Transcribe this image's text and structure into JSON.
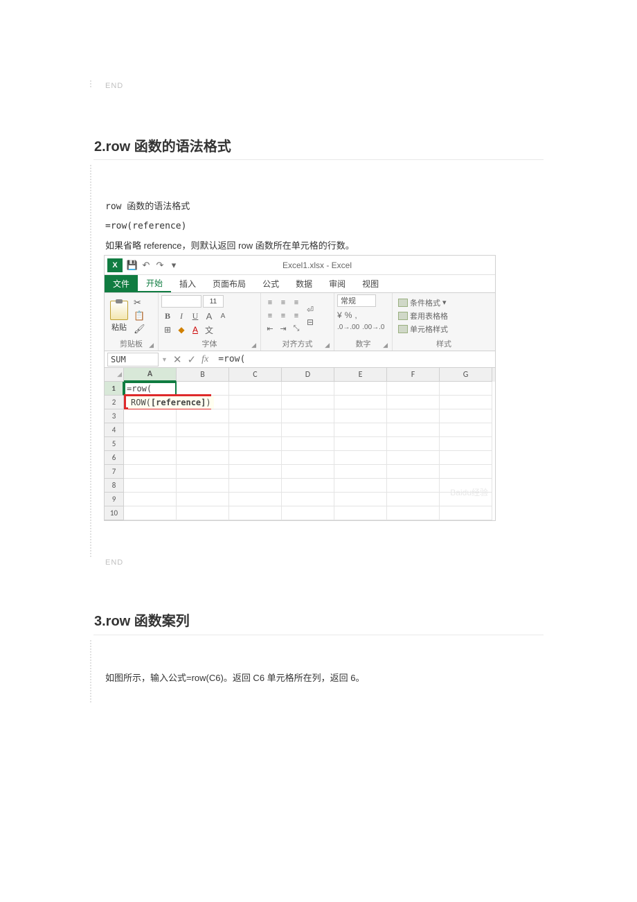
{
  "endLabel": "END",
  "section2": {
    "heading": "2.row 函数的语法格式",
    "line1": "row 函数的语法格式",
    "line2": "=row(reference)",
    "line3": "如果省略 reference，则默认返回 row 函数所在单元格的行数。"
  },
  "section3": {
    "heading": "3.row 函数案列",
    "line1": "如图所示，输入公式=row(C6)。返回 C6 单元格所在列，返回 6。"
  },
  "excel": {
    "title": "Excel1.xlsx - Excel",
    "qat": {
      "save": "💾",
      "undo": "↶",
      "redo": "↷"
    },
    "tabs": {
      "file": "文件",
      "home": "开始",
      "insert": "插入",
      "layout": "页面布局",
      "formulas": "公式",
      "data": "数据",
      "review": "审阅",
      "view": "视图"
    },
    "ribbon": {
      "clipboard": {
        "paste": "粘贴",
        "label": "剪贴板",
        "cut": "✂",
        "copy": "📋",
        "brush": "🖌"
      },
      "font": {
        "label": "字体",
        "size": "11",
        "b": "B",
        "i": "I",
        "u": "U",
        "grow": "A",
        "shrink": "A"
      },
      "alignment": {
        "label": "对齐方式"
      },
      "number": {
        "label": "数字",
        "general": "常规",
        "pct": "%",
        "comma": ","
      },
      "styles": {
        "label": "样式",
        "cond": "条件格式",
        "table": "套用表格格",
        "cell": "单元格样式"
      }
    },
    "fxbar": {
      "nameBox": "SUM",
      "cancel": "✕",
      "enter": "✓",
      "fx": "fx",
      "formula": "=row("
    },
    "columns": [
      "A",
      "B",
      "C",
      "D",
      "E",
      "F",
      "G"
    ],
    "rows": [
      "1",
      "2",
      "3",
      "4",
      "5",
      "6",
      "7",
      "8",
      "9",
      "10"
    ],
    "cellA1": "=row(",
    "tooltip": {
      "fn": "ROW(",
      "arg": "[reference]",
      "close": ")"
    },
    "watermark": "Baidu经验"
  }
}
